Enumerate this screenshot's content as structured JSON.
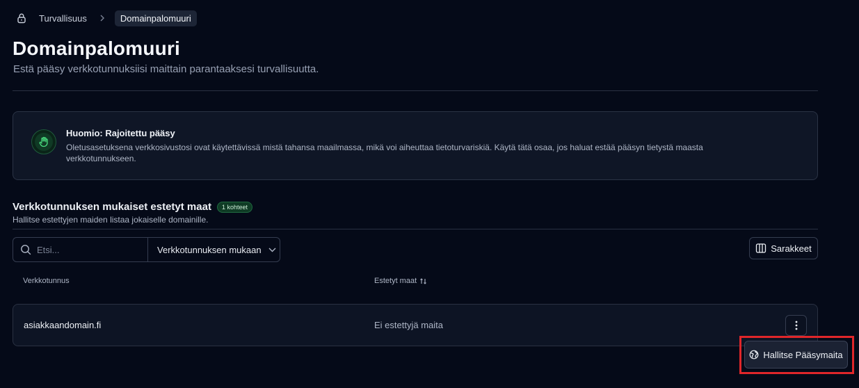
{
  "breadcrumb": {
    "icon": "lock-icon",
    "parent": "Turvallisuus",
    "current": "Domainpalomuuri"
  },
  "page": {
    "title": "Domainpalomuuri",
    "subtitle": "Estä pääsy verkkotunnuksiisi maittain parantaaksesi turvallisuutta."
  },
  "alert": {
    "icon": "hand-stop-icon",
    "title": "Huomio: Rajoitettu pääsy",
    "text": "Oletusasetuksena verkkosivustosi ovat käytettävissä mistä tahansa maailmassa, mikä voi aiheuttaa tietoturvariskiä. Käytä tätä osaa, jos haluat estää pääsyn tietystä maasta verkkotunnukseen.",
    "accent_color": "#22c55e"
  },
  "section": {
    "title": "Verkkotunnuksen mukaiset estetyt maat",
    "badge": "1 kohteet",
    "subtitle": "Hallitse estettyjen maiden listaa jokaiselle domainille."
  },
  "toolbar": {
    "search_placeholder": "Etsi...",
    "search_value": "",
    "filter_label": "Verkkotunnuksen mukaan",
    "columns_label": "Sarakkeet"
  },
  "table": {
    "headers": {
      "domain": "Verkkotunnus",
      "countries": "Estetyt maat"
    },
    "rows": [
      {
        "domain": "asiakkaandomain.fi",
        "countries": "Ei estettyjä maita"
      }
    ]
  },
  "row_menu": {
    "manage_label": "Hallitse Pääsymaita",
    "icon": "globe-icon",
    "highlight_color": "#e0262a"
  }
}
